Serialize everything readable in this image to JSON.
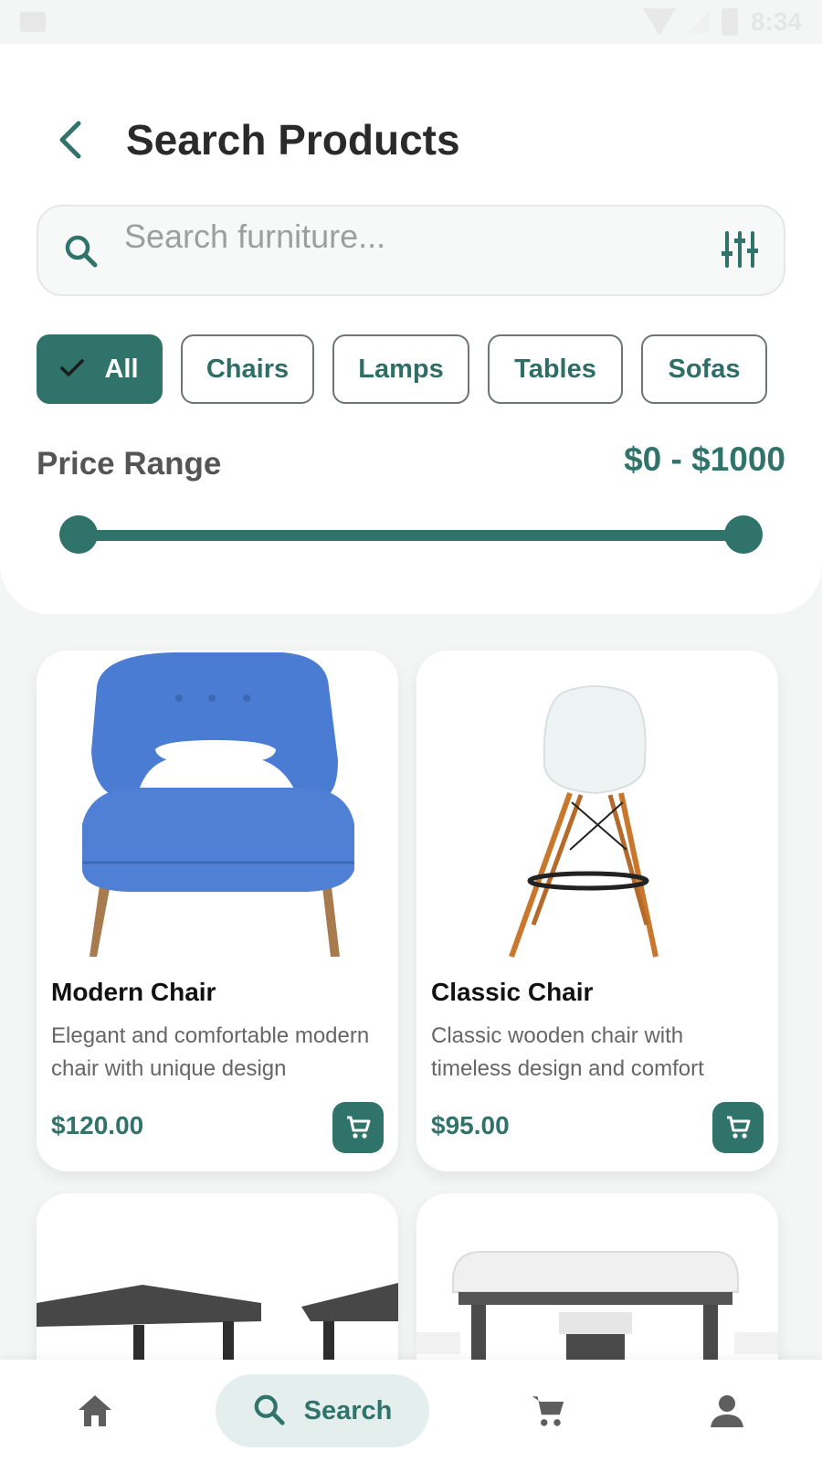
{
  "status_bar": {
    "time": "8:34"
  },
  "header": {
    "title": "Search Products"
  },
  "search": {
    "value": "",
    "placeholder": "Search furniture..."
  },
  "categories": [
    {
      "label": "All",
      "selected": true
    },
    {
      "label": "Chairs",
      "selected": false
    },
    {
      "label": "Lamps",
      "selected": false
    },
    {
      "label": "Tables",
      "selected": false
    },
    {
      "label": "Sofas",
      "selected": false
    }
  ],
  "price_range": {
    "label": "Price Range",
    "display": "$0 - $1000",
    "min": 0,
    "max": 1000,
    "selected_min": 0,
    "selected_max": 1000
  },
  "products": [
    {
      "name": "Modern Chair",
      "description": "Elegant and comfortable modern chair with unique design",
      "price": "$120.00",
      "image": "blue-armchair-image"
    },
    {
      "name": "Classic Chair",
      "description": "Classic wooden chair with timeless design and comfort",
      "price": "$95.00",
      "image": "white-bar-stool-image"
    },
    {
      "name": "",
      "description": "",
      "price": "",
      "image": "dark-tables-image"
    },
    {
      "name": "",
      "description": "",
      "price": "",
      "image": "white-table-image"
    }
  ],
  "bottom_nav": {
    "items": [
      {
        "label": "Home",
        "icon": "home-icon",
        "active": false
      },
      {
        "label": "Search",
        "icon": "search-icon",
        "active": true
      },
      {
        "label": "Cart",
        "icon": "cart-icon",
        "active": false
      },
      {
        "label": "Profile",
        "icon": "profile-icon",
        "active": false
      }
    ]
  },
  "colors": {
    "primary": "#2f736b",
    "background": "#f4f5f5",
    "chip_border": "#6e7573"
  }
}
